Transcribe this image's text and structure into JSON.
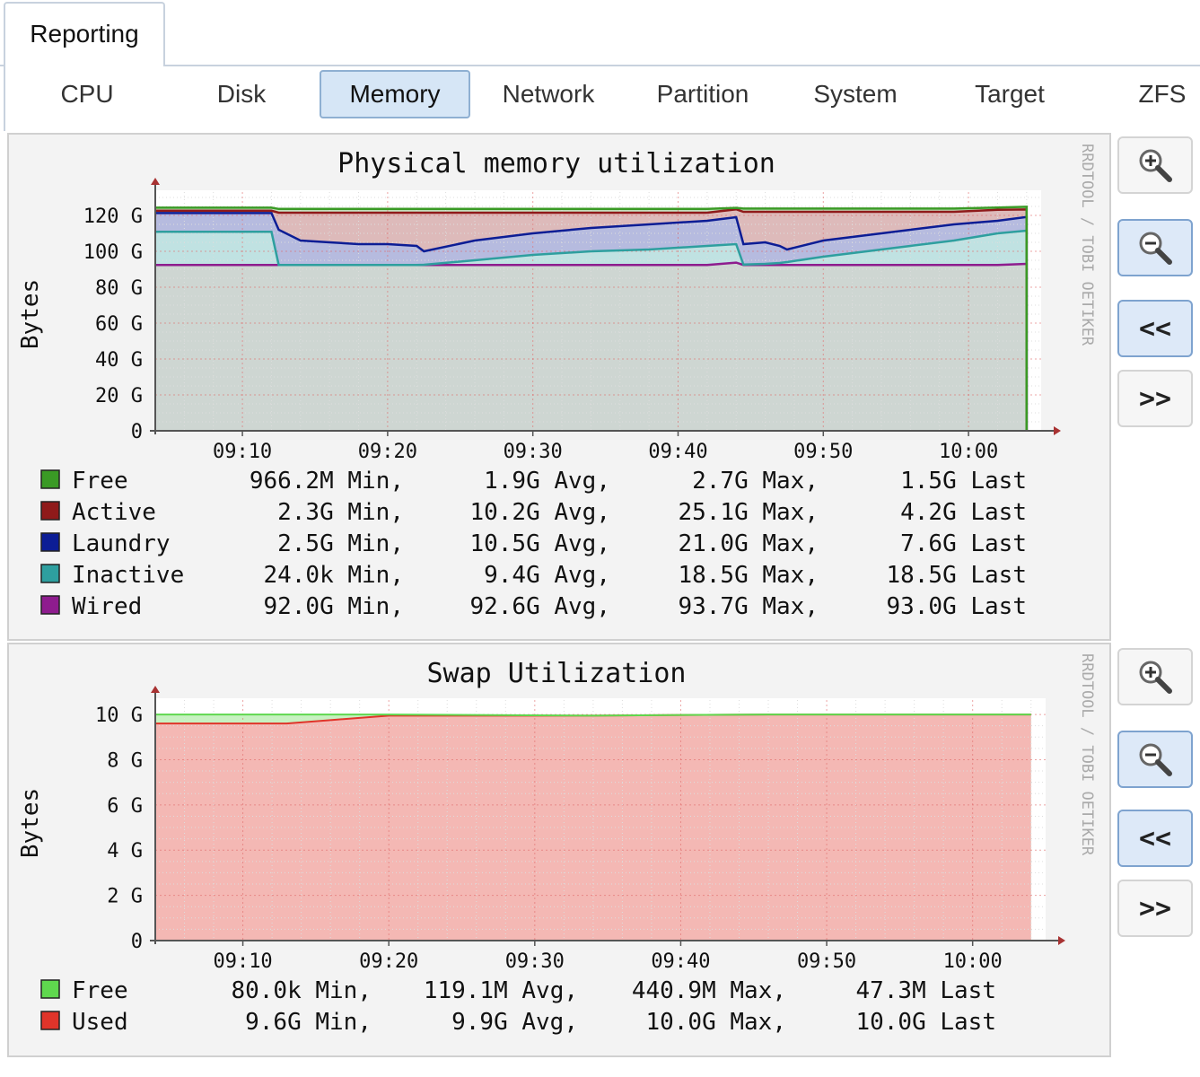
{
  "main_tab": {
    "label": "Reporting"
  },
  "subtabs": [
    {
      "label": "CPU",
      "active": false
    },
    {
      "label": "Disk",
      "active": false
    },
    {
      "label": "Memory",
      "active": true
    },
    {
      "label": "Network",
      "active": false
    },
    {
      "label": "Partition",
      "active": false
    },
    {
      "label": "System",
      "active": false
    },
    {
      "label": "Target",
      "active": false
    },
    {
      "label": "ZFS",
      "active": false
    }
  ],
  "controls": {
    "back_label": "<<",
    "forward_label": ">>",
    "zoom_in_icon": "zoom-in-icon",
    "zoom_out_icon": "zoom-out-icon"
  },
  "watermark": "RRDTOOL / TOBI OETIKER",
  "chart_data": [
    {
      "type": "area",
      "title": "Physical memory utilization",
      "ylabel": "Bytes",
      "yticks": [
        "0",
        "20 G",
        "40 G",
        "60 G",
        "80 G",
        "100 G",
        "120 G"
      ],
      "ylim": [
        0,
        130
      ],
      "xticks": [
        "09:10",
        "09:20",
        "09:30",
        "09:40",
        "09:50",
        "10:00"
      ],
      "xlim": [
        "09:04",
        "10:05"
      ],
      "grid": true,
      "x": [
        "09:04",
        "09:12",
        "09:12.5",
        "09:14",
        "09:16",
        "09:18",
        "09:20",
        "09:22",
        "09:22.5",
        "09:26",
        "09:30",
        "09:34",
        "09:38",
        "09:42",
        "09:44",
        "09:44.5",
        "09:46",
        "09:47",
        "09:47.5",
        "09:50",
        "09:53",
        "09:56",
        "09:59",
        "10:02",
        "10:04"
      ],
      "series": [
        {
          "name": "Wired",
          "color": "#8e1c8e",
          "values": [
            92.4,
            92.4,
            92.4,
            92.4,
            92.4,
            92.4,
            92.4,
            92.4,
            92.4,
            92.4,
            92.4,
            92.4,
            92.4,
            92.4,
            93.7,
            92.4,
            92.4,
            92.4,
            92.4,
            92.4,
            92.4,
            92.4,
            92.4,
            92.4,
            93.0
          ]
        },
        {
          "name": "Inactive",
          "color": "#2e9f9f",
          "values": [
            110.9,
            110.9,
            92.4,
            92.4,
            92.4,
            92.4,
            92.4,
            92.4,
            92.5,
            95,
            98,
            100,
            101,
            103,
            104,
            92.6,
            93,
            93.5,
            94,
            97,
            100,
            103,
            106,
            110,
            111.5
          ]
        },
        {
          "name": "Laundry",
          "color": "#0c1d95",
          "values": [
            121.3,
            121.3,
            112,
            106,
            105,
            104,
            104,
            103,
            100,
            106,
            110,
            113,
            115,
            117,
            119,
            104,
            105,
            103,
            101,
            106,
            109,
            112,
            115,
            117,
            119.1
          ]
        },
        {
          "name": "Active",
          "color": "#8f1a1a",
          "values": [
            122.6,
            122.6,
            121.5,
            121.5,
            121.5,
            121.5,
            121.5,
            121.5,
            121.5,
            121.5,
            121.5,
            121.5,
            121.5,
            121.5,
            123.4,
            122,
            122,
            122,
            122,
            122,
            122,
            122,
            122,
            123.1,
            123.3
          ]
        },
        {
          "name": "Free",
          "color": "#3a9a25",
          "values": [
            124.3,
            124.3,
            123.6,
            123.6,
            123.6,
            123.6,
            123.6,
            123.6,
            123.6,
            123.6,
            123.6,
            123.6,
            123.6,
            123.6,
            124.2,
            123.8,
            123.8,
            123.8,
            123.8,
            123.8,
            123.8,
            123.8,
            123.8,
            124.4,
            124.8
          ]
        }
      ],
      "legend": [
        {
          "name": "Free",
          "color": "#3a9a25",
          "min": "966.2M Min,",
          "avg": "1.9G Avg,",
          "max": "2.7G Max,",
          "last": "1.5G Last"
        },
        {
          "name": "Active",
          "color": "#8f1a1a",
          "min": "2.3G Min,",
          "avg": "10.2G Avg,",
          "max": "25.1G Max,",
          "last": "4.2G Last"
        },
        {
          "name": "Laundry",
          "color": "#0c1d95",
          "min": "2.5G Min,",
          "avg": "10.5G Avg,",
          "max": "21.0G Max,",
          "last": "7.6G Last"
        },
        {
          "name": "Inactive",
          "color": "#2e9f9f",
          "min": "24.0k Min,",
          "avg": "9.4G Avg,",
          "max": "18.5G Max,",
          "last": "18.5G Last"
        },
        {
          "name": "Wired",
          "color": "#8e1c8e",
          "min": "92.0G Min,",
          "avg": "92.6G Avg,",
          "max": "93.7G Max,",
          "last": "93.0G Last"
        }
      ]
    },
    {
      "type": "area",
      "title": "Swap Utilization",
      "ylabel": "Bytes",
      "yticks": [
        "0",
        "2 G",
        "4 G",
        "6 G",
        "8 G",
        "10 G"
      ],
      "ylim": [
        0,
        10.4
      ],
      "xticks": [
        "09:10",
        "09:20",
        "09:30",
        "09:40",
        "09:50",
        "10:00"
      ],
      "xlim": [
        "09:04",
        "10:05"
      ],
      "grid": true,
      "x": [
        "09:04",
        "09:13",
        "09:16",
        "09:20",
        "09:34",
        "09:46",
        "10:04"
      ],
      "series": [
        {
          "name": "Used",
          "color": "#e0342a",
          "values": [
            9.6,
            9.6,
            9.75,
            9.95,
            9.95,
            10.0,
            10.0
          ]
        },
        {
          "name": "Free",
          "color": "#5fd84e",
          "values": [
            10.0,
            10.0,
            10.0,
            10.0,
            9.95,
            10.0,
            10.0
          ]
        }
      ],
      "legend": [
        {
          "name": "Free",
          "color": "#5fd84e",
          "min": "80.0k Min,",
          "avg": "119.1M Avg,",
          "max": "440.9M Max,",
          "last": "47.3M Last"
        },
        {
          "name": "Used",
          "color": "#e0342a",
          "min": "9.6G Min,",
          "avg": "9.9G Avg,",
          "max": "10.0G Max,",
          "last": "10.0G Last"
        }
      ]
    }
  ]
}
